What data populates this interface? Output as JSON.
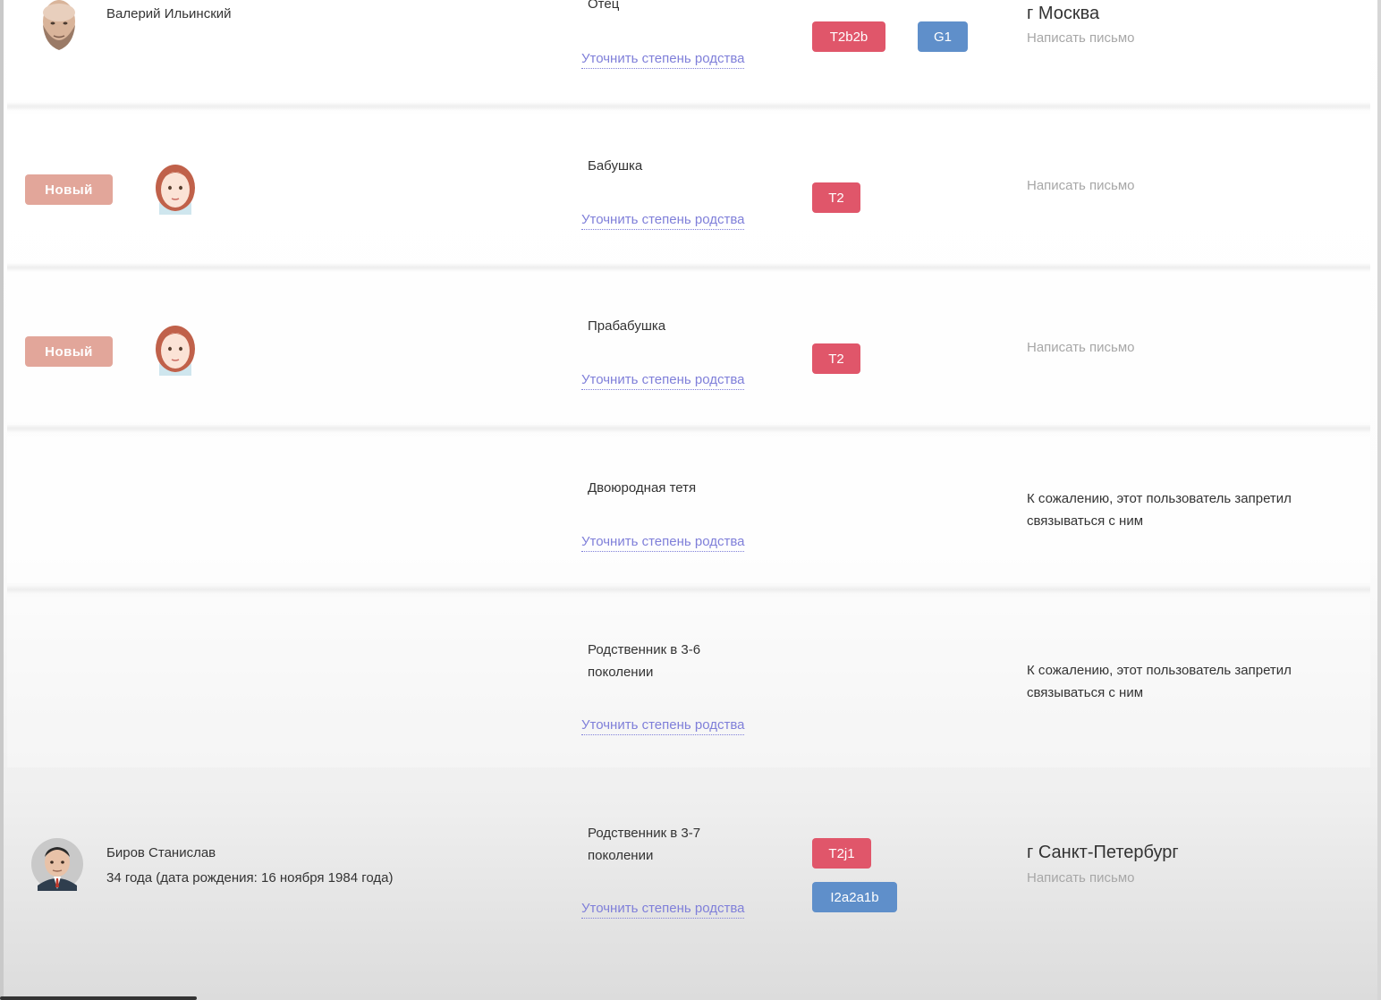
{
  "common": {
    "refine_link": "Уточнить степень родства",
    "write_letter": "Написать письмо",
    "new_badge": "Новый",
    "restricted": "К сожалению, этот пользователь запретил связываться с ним"
  },
  "rows": [
    {
      "name": "Валерий Ильинский",
      "relation": "Отец",
      "haplogroups": [
        {
          "label": "T2b2b",
          "color": "#e0566a"
        },
        {
          "label": "G1",
          "color": "#5f8fca"
        }
      ],
      "city": "г Москва"
    },
    {
      "relation": "Бабушка",
      "haplogroups": [
        {
          "label": "T2",
          "color": "#e0566a"
        }
      ]
    },
    {
      "relation": "Прабабушка",
      "haplogroups": [
        {
          "label": "T2",
          "color": "#e0566a"
        }
      ]
    },
    {
      "relation": "Двоюродная тетя"
    },
    {
      "relation": "Родственник в 3-6 поколении"
    },
    {
      "name": "Биров Станислав",
      "age": "34 года (дата рождения: 16 ноября 1984 года)",
      "relation": "Родственник в 3-7 поколении",
      "haplogroups": [
        {
          "label": "T2j1",
          "color": "#e0566a"
        },
        {
          "label": "I2a2a1b",
          "color": "#5f8fca"
        }
      ],
      "city": "г Санкт-Петербург"
    }
  ]
}
